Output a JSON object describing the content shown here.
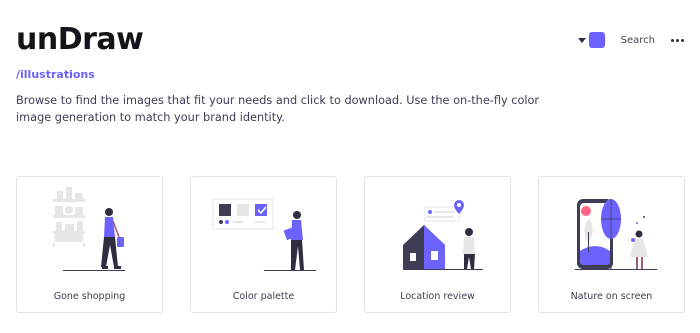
{
  "header": {
    "logo": "unDraw",
    "route": "/illustrations",
    "intro": "Browse to find the images that fit your needs and click to download. Use the on-the-fly color image generation to match your brand identity.",
    "search_label": "Search"
  },
  "colors": {
    "accent": "#6c63ff",
    "dark": "#2f2e41",
    "gray": "#e6e6e6"
  },
  "icons": {
    "color_dropdown": "caret-down-icon",
    "color_swatch": "color-swatch-icon",
    "more": "more-dots-icon"
  },
  "illustrations": [
    {
      "title": "Gone shopping"
    },
    {
      "title": "Color palette"
    },
    {
      "title": "Location review"
    },
    {
      "title": "Nature on screen"
    }
  ]
}
